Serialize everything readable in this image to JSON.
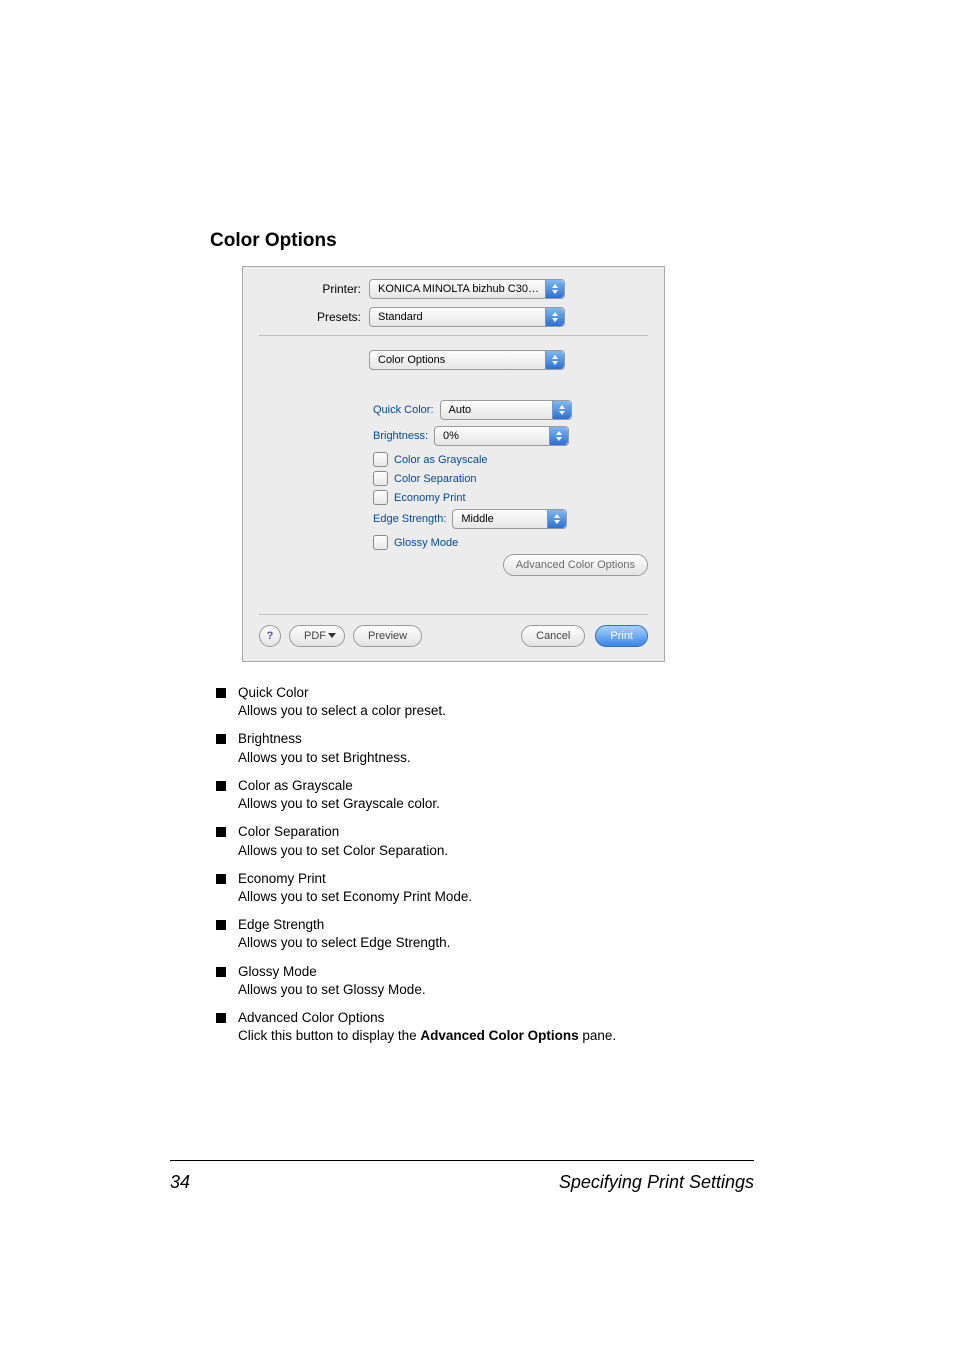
{
  "heading": "Color Options",
  "dialog": {
    "printer_label": "Printer:",
    "printer_value": "KONICA MINOLTA bizhub C30…",
    "presets_label": "Presets:",
    "presets_value": "Standard",
    "panel_value": "Color Options",
    "quick_color_label": "Quick Color:",
    "quick_color_value": "Auto",
    "brightness_label": "Brightness:",
    "brightness_value": "0%",
    "chk_grayscale": "Color as Grayscale",
    "chk_separation": "Color Separation",
    "chk_economy": "Economy Print",
    "edge_label": "Edge Strength:",
    "edge_value": "Middle",
    "chk_glossy": "Glossy Mode",
    "adv_btn": "Advanced Color Options",
    "help": "?",
    "pdf_btn": "PDF",
    "preview_btn": "Preview",
    "cancel_btn": "Cancel",
    "print_btn": "Print"
  },
  "items": [
    {
      "title": "Quick Color",
      "text": "Allows you to select a color preset."
    },
    {
      "title": "Brightness",
      "text": "Allows you to set Brightness."
    },
    {
      "title": "Color as Grayscale",
      "text": "Allows you to set Grayscale color."
    },
    {
      "title": "Color Separation",
      "text": "Allows you to set Color Separation."
    },
    {
      "title": "Economy Print",
      "text": "Allows you to set Economy Print Mode."
    },
    {
      "title": "Edge Strength",
      "text": "Allows you to select Edge Strength."
    },
    {
      "title": "Glossy Mode",
      "text": "Allows you to set Glossy Mode."
    },
    {
      "title": "Advanced Color Options",
      "text_pre": "Click this button to display the ",
      "text_bold": "Advanced Color Options",
      "text_post": " pane."
    }
  ],
  "footer": {
    "page": "34",
    "title": "Specifying Print Settings"
  }
}
